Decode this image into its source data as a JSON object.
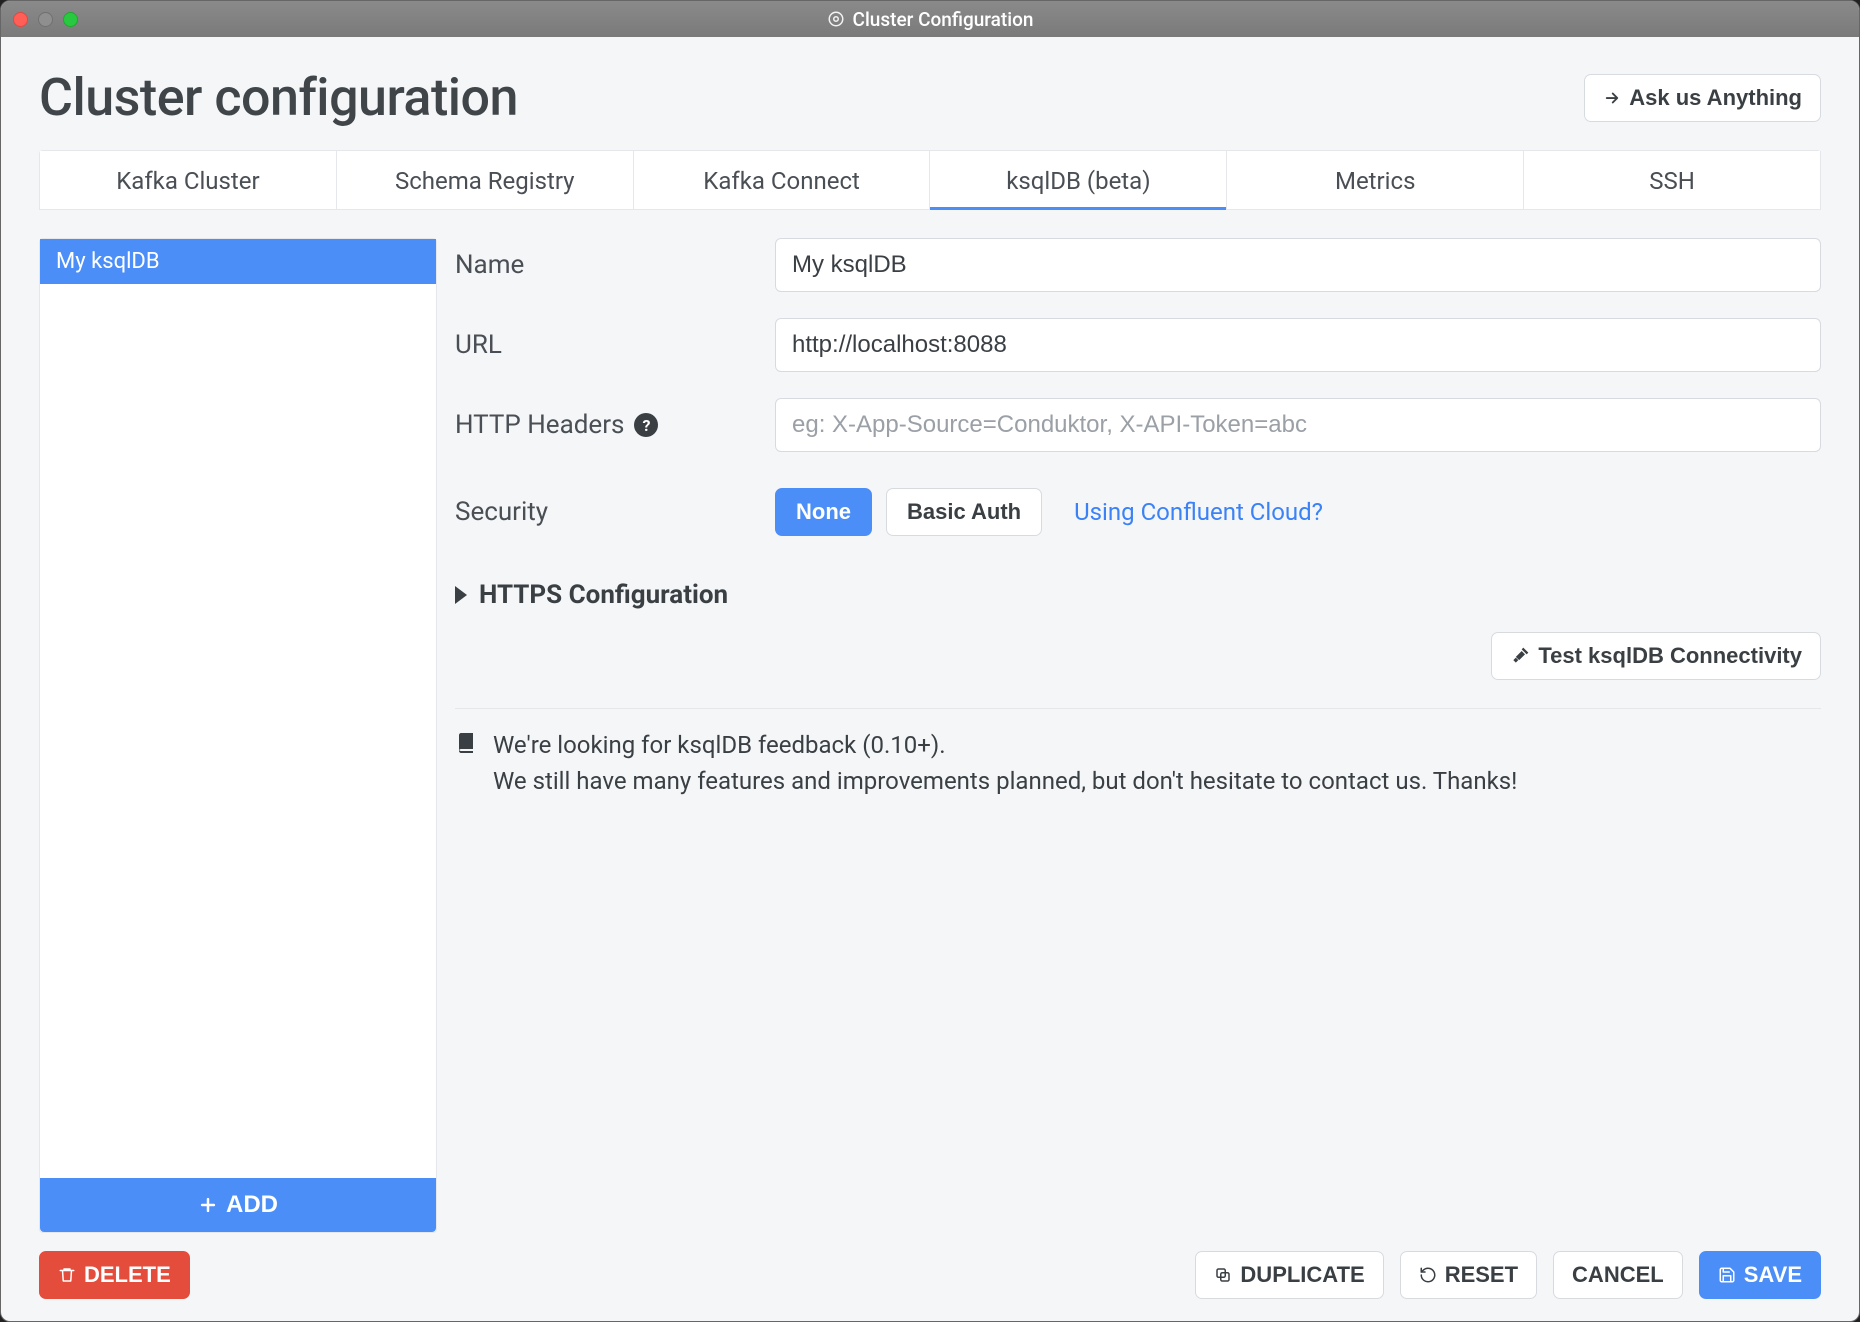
{
  "window": {
    "title": "Cluster Configuration"
  },
  "header": {
    "title": "Cluster configuration",
    "ask_button": "Ask us Anything"
  },
  "tabs": [
    {
      "label": "Kafka Cluster"
    },
    {
      "label": "Schema Registry"
    },
    {
      "label": "Kafka Connect"
    },
    {
      "label": "ksqlDB (beta)",
      "active": true
    },
    {
      "label": "Metrics"
    },
    {
      "label": "SSH"
    }
  ],
  "sidebar": {
    "items": [
      {
        "label": "My ksqlDB",
        "selected": true
      }
    ],
    "add_label": "ADD"
  },
  "form": {
    "name": {
      "label": "Name",
      "value": "My ksqlDB"
    },
    "url": {
      "label": "URL",
      "value": "http://localhost:8088"
    },
    "headers": {
      "label": "HTTP Headers",
      "placeholder": "eg: X-App-Source=Conduktor, X-API-Token=abc",
      "value": ""
    },
    "security": {
      "label": "Security",
      "options": {
        "none": "None",
        "basic": "Basic Auth"
      },
      "cloud_link": "Using Confluent Cloud?"
    },
    "https_accordion": "HTTPS Configuration",
    "test_button": "Test ksqlDB Connectivity",
    "note_line1": "We're looking for ksqlDB feedback (0.10+).",
    "note_line2": "We still have many features and improvements planned, but don't hesitate to contact us. Thanks!"
  },
  "footer": {
    "delete": "DELETE",
    "duplicate": "DUPLICATE",
    "reset": "RESET",
    "cancel": "CANCEL",
    "save": "SAVE"
  }
}
